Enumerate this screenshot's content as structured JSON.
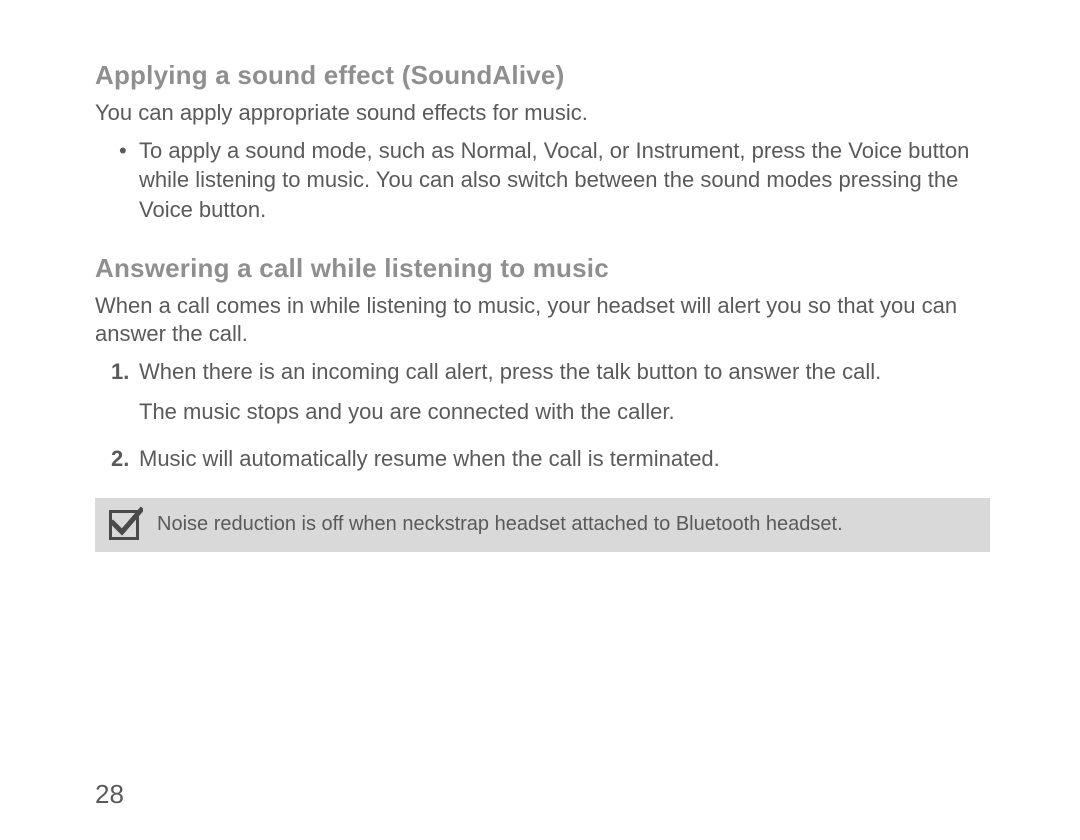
{
  "sections": {
    "sound_effect": {
      "heading": "Applying a sound effect (SoundAlive)",
      "intro": "You can apply appropriate sound effects for music.",
      "bullet": "To apply a sound mode, such as Normal, Vocal, or Instrument, press the Voice button while listening to music. You can also switch between the sound modes pressing the Voice button."
    },
    "answering_call": {
      "heading": "Answering a call while listening to music",
      "intro": "When a call comes in while listening to music, your headset will alert you so that you can answer the call.",
      "step1": "When there is an incoming call alert, press the talk button to answer the call.",
      "step1_sub": "The music stops and you are connected with the caller.",
      "step2": "Music will automatically resume when the call is terminated."
    },
    "note": "Noise reduction is off when neckstrap headset attached to Bluetooth headset."
  },
  "page_number": "28"
}
